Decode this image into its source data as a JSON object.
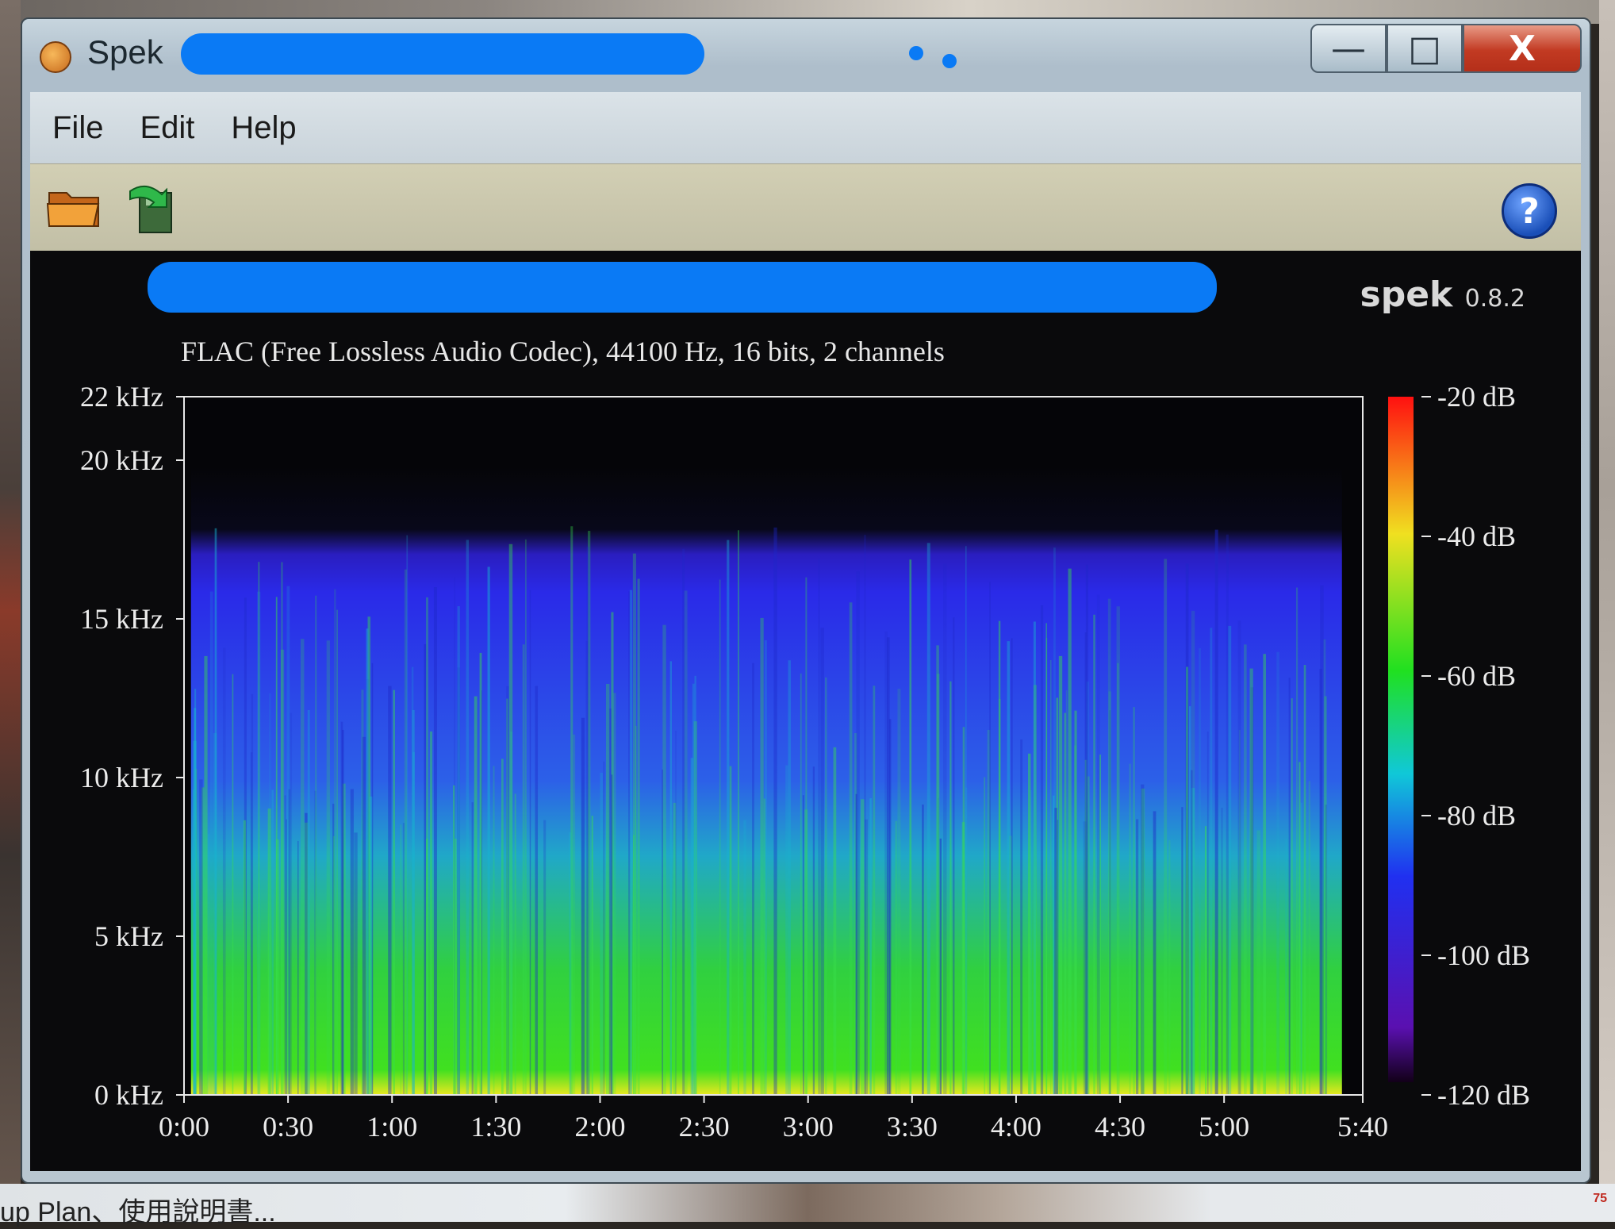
{
  "window": {
    "title": "Spek"
  },
  "menu": {
    "items": [
      "File",
      "Edit",
      "Help"
    ]
  },
  "toolbar": {
    "open_icon": "folder-open-icon",
    "save_icon": "save-icon",
    "help_icon": "help-icon",
    "help_glyph": "?"
  },
  "window_controls": {
    "minimize": "—",
    "maximize": "□",
    "close": "X"
  },
  "spek": {
    "brand": "spek",
    "version": "0.8.2"
  },
  "file_info": "FLAC (Free Lossless Audio Codec), 44100 Hz, 16 bits, 2 channels",
  "chart_data": {
    "type": "heatmap",
    "xlabel": "",
    "ylabel": "",
    "x_ticks": [
      "0:00",
      "0:30",
      "1:00",
      "1:30",
      "2:00",
      "2:30",
      "3:00",
      "3:30",
      "4:00",
      "4:30",
      "5:00",
      "5:40"
    ],
    "x_tick_seconds": [
      0,
      30,
      60,
      90,
      120,
      150,
      180,
      210,
      240,
      270,
      300,
      340
    ],
    "xlim": [
      0,
      340
    ],
    "y_ticks": [
      "0 kHz",
      "5 kHz",
      "10 kHz",
      "15 kHz",
      "20 kHz",
      "22 kHz"
    ],
    "y_tick_khz": [
      0,
      5,
      10,
      15,
      20,
      22
    ],
    "ylim": [
      0,
      22
    ],
    "colorbar_ticks": [
      "-20 dB",
      "-40 dB",
      "-60 dB",
      "-80 dB",
      "-100 dB",
      "-120 dB"
    ],
    "colorbar_db": [
      -20,
      -40,
      -60,
      -80,
      -100,
      -120
    ],
    "clim": [
      -120,
      -20
    ],
    "content_cutoff_khz": 19.5,
    "colors": {
      "high": "#ff2010",
      "mid": "#20e020",
      "low": "#2030e0",
      "floor": "#0a0a20"
    }
  },
  "taskbar": {
    "text": "up Plan、使用說明書..."
  }
}
